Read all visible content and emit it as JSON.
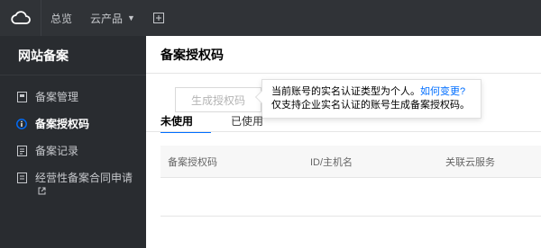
{
  "topbar": {
    "logo_icon": "cloud-logo-icon",
    "nav": [
      {
        "label": "总览"
      },
      {
        "label": "云产品"
      }
    ],
    "plus_icon": "add-square-icon"
  },
  "sidebar": {
    "title": "网站备案",
    "items": [
      {
        "label": "备案管理",
        "icon": "document-icon",
        "active": false
      },
      {
        "label": "备案授权码",
        "icon": "info-circle-icon",
        "active": true
      },
      {
        "label": "备案记录",
        "icon": "list-icon",
        "active": false
      },
      {
        "label": "经营性备案合同申请",
        "icon": "contract-icon",
        "active": false,
        "external": true
      }
    ]
  },
  "main": {
    "title": "备案授权码",
    "generate_button": "生成授权码",
    "tooltip": {
      "text_before": "当前账号的实名认证类型为个人。",
      "link": "如何变更?",
      "text_after": " 仅支持企业实名认证的账号生成备案授权码。"
    },
    "tabs": [
      {
        "label": "未使用",
        "active": true
      },
      {
        "label": "已使用",
        "active": false
      }
    ],
    "table": {
      "columns": [
        "备案授权码",
        "ID/主机名",
        "关联云服务"
      ]
    }
  },
  "colors": {
    "accent": "#006eff",
    "topbar_bg": "#303337",
    "sidebar_bg": "#292c30"
  }
}
